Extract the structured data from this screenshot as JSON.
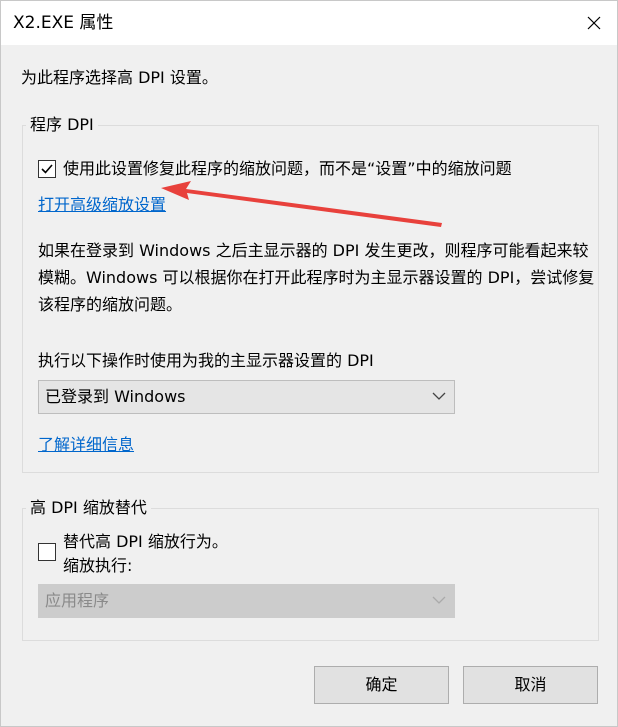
{
  "window": {
    "title": "X2.EXE 属性",
    "close_icon": "close-icon"
  },
  "intro": "为此程序选择高 DPI 设置。",
  "program_dpi": {
    "legend": "程序 DPI",
    "checkbox_checked": true,
    "checkbox_label": "使用此设置修复此程序的缩放问题，而不是“设置”中的缩放问题",
    "advanced_link": "打开高级缩放设置",
    "description": "如果在登录到 Windows 之后主显示器的 DPI 发生更改，则程序可能看起来较模糊。Windows 可以根据你在打开此程序时为主显示器设置的 DPI，尝试修复该程序的缩放问题。",
    "select_label": "执行以下操作时使用为我的主显示器设置的 DPI",
    "select_value": "已登录到 Windows",
    "learn_more_link": "了解详细信息"
  },
  "override": {
    "legend": "高 DPI 缩放替代",
    "checkbox_checked": false,
    "checkbox_label": "替代高 DPI 缩放行为。",
    "sub_label": "缩放执行:",
    "select_value": "应用程序",
    "select_disabled": true
  },
  "buttons": {
    "ok": "确定",
    "cancel": "取消"
  },
  "annotation": {
    "arrow_color": "#e8413c"
  }
}
